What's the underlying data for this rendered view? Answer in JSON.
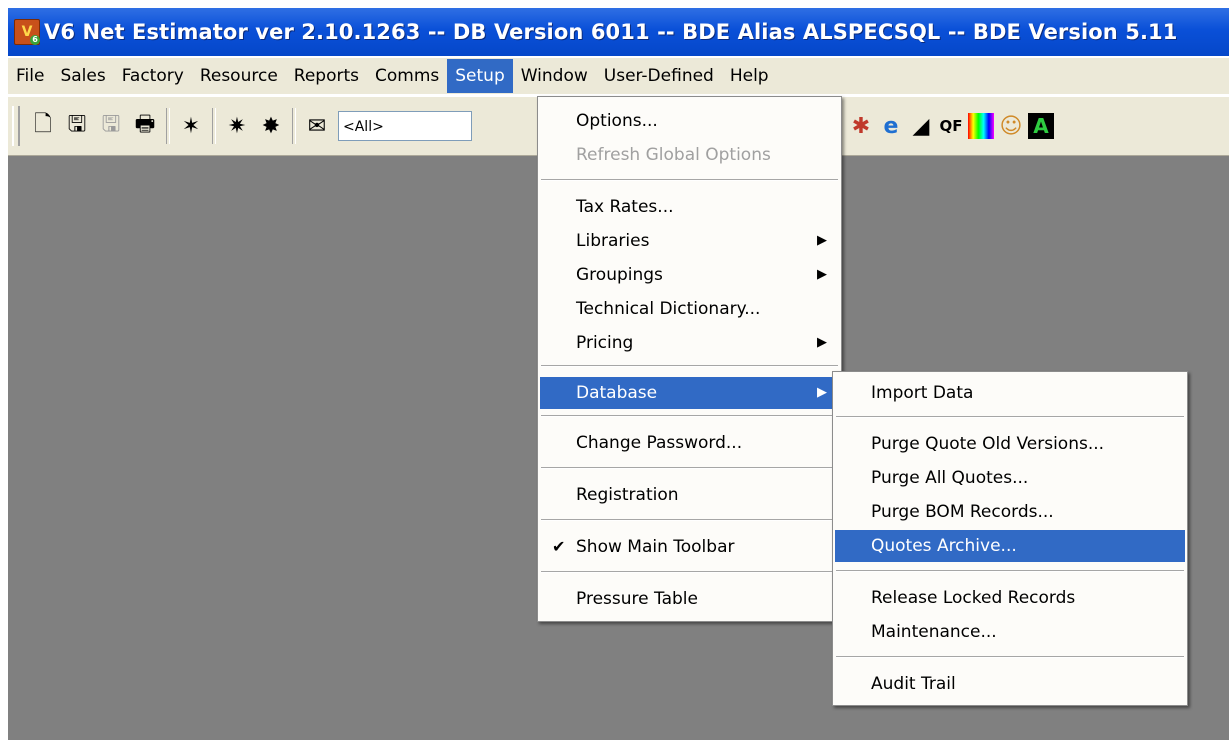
{
  "titlebar": {
    "title": "V6 Net Estimator ver 2.10.1263 -- DB Version 6011 -- BDE Alias ALSPECSQL -- BDE Version 5.11"
  },
  "menubar": {
    "items": [
      "File",
      "Sales",
      "Factory",
      "Resource",
      "Reports",
      "Comms",
      "Setup",
      "Window",
      "User-Defined",
      "Help"
    ],
    "active": "Setup"
  },
  "toolbar": {
    "filter_value": "<All>",
    "qf_label": "QF"
  },
  "setup_menu": {
    "options": "Options...",
    "refresh_global_options": "Refresh Global Options",
    "tax_rates": "Tax Rates...",
    "libraries": "Libraries",
    "groupings": "Groupings",
    "technical_dictionary": "Technical Dictionary...",
    "pricing": "Pricing",
    "database": "Database",
    "change_password": "Change Password...",
    "registration": "Registration",
    "show_main_toolbar": "Show Main Toolbar",
    "pressure_table": "Pressure Table"
  },
  "database_submenu": {
    "import_data": "Import Data",
    "purge_quote_old_versions": "Purge Quote Old Versions...",
    "purge_all_quotes": "Purge All Quotes...",
    "purge_bom_records": "Purge BOM Records...",
    "quotes_archive": "Quotes Archive...",
    "release_locked_records": "Release Locked Records",
    "maintenance": "Maintenance...",
    "audit_trail": "Audit Trail"
  },
  "colors": {
    "titlebar": "#0a50d8",
    "highlight": "#316ac5",
    "workspace": "#808080",
    "chrome": "#ece9d8"
  }
}
